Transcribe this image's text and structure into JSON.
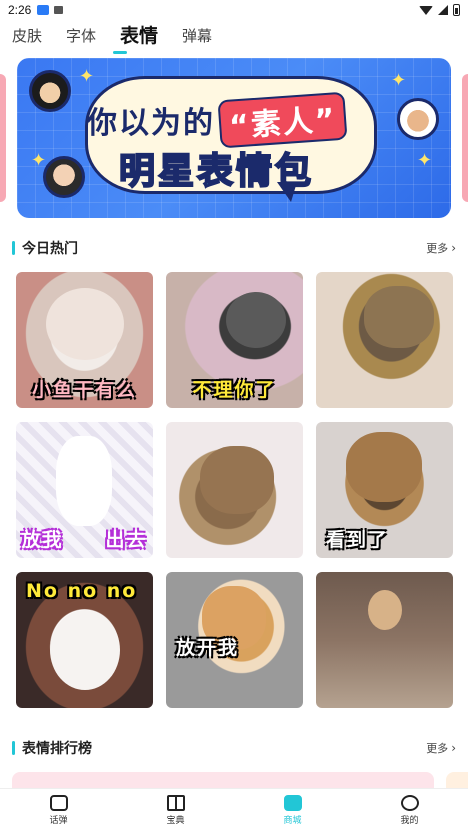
{
  "status_bar": {
    "time": "2:26"
  },
  "tabs": [
    {
      "label": "皮肤"
    },
    {
      "label": "字体"
    },
    {
      "label": "表情"
    },
    {
      "label": "弹幕"
    }
  ],
  "banner": {
    "line1_prefix": "你以为的",
    "line1_quote": "“素人”",
    "line2": "明星表情包"
  },
  "sections": {
    "hot": {
      "title": "今日热门",
      "more": "更多"
    },
    "rank": {
      "title": "表情排行榜",
      "more": "更多"
    }
  },
  "stickers": [
    {
      "caption": "小鱼干有么"
    },
    {
      "caption": "不理你了"
    },
    {
      "caption": ""
    },
    {
      "caption": "放我　　出去"
    },
    {
      "caption": ""
    },
    {
      "caption": "看到了"
    },
    {
      "caption": "No no no"
    },
    {
      "caption": "放开我"
    },
    {
      "caption": ""
    }
  ],
  "bottom_nav": [
    {
      "label": "话弹",
      "icon": "chat-icon"
    },
    {
      "label": "宝典",
      "icon": "book-icon"
    },
    {
      "label": "商城",
      "icon": "shop-icon"
    },
    {
      "label": "我的",
      "icon": "profile-icon"
    }
  ],
  "colors": {
    "accent": "#22c6d6",
    "banner_bg": "#3a78f2"
  }
}
